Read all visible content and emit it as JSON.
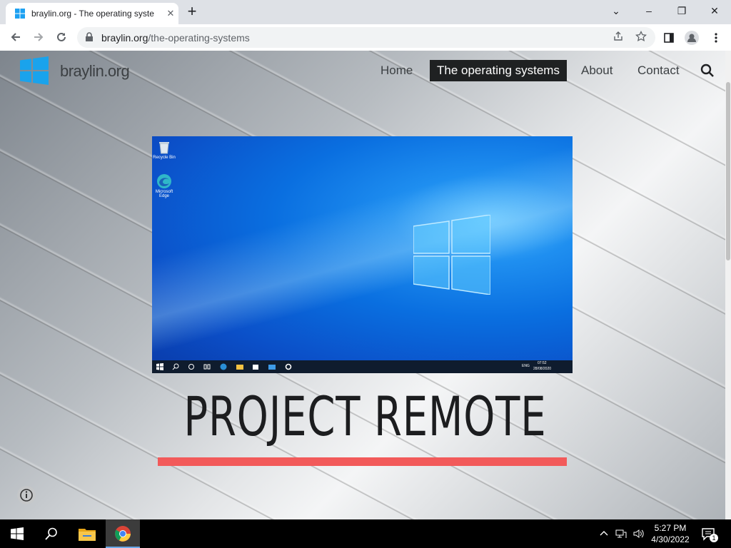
{
  "browser": {
    "tab_title": "braylin.org - The operating syste",
    "url_host": "braylin.org",
    "url_path": "/the-operating-systems",
    "minimize_glyph": "–",
    "restore_glyph": "❐",
    "close_glyph": "✕",
    "dropdown_glyph": "⌄",
    "newtab_glyph": "+",
    "tab_close_glyph": "✕"
  },
  "site": {
    "name": "braylin.org",
    "nav": [
      {
        "label": "Home"
      },
      {
        "label": "The operating systems"
      },
      {
        "label": "About"
      },
      {
        "label": "Contact"
      }
    ],
    "headline": "PROJECT REMOTE",
    "accent_color": "#f25a5a"
  },
  "screenshot": {
    "desktop_icons": [
      {
        "label": "Recycle Bin",
        "icon": "recycle-bin-icon"
      },
      {
        "label": "Microsoft Edge",
        "icon": "edge-icon"
      }
    ],
    "tray_lang": "ENG",
    "tray_time": "07:52",
    "tray_date": "28/08/2020"
  },
  "taskbar": {
    "time": "5:27 PM",
    "date": "4/30/2022",
    "notification_count": "1",
    "apps": [
      "start-icon",
      "search-icon",
      "file-explorer-icon",
      "chrome-icon"
    ]
  }
}
